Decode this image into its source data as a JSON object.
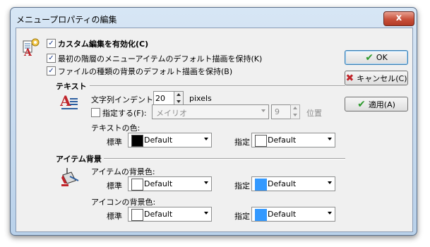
{
  "window": {
    "title": "メニュープロパティの編集",
    "close_glyph": "x"
  },
  "options": {
    "enable_custom": {
      "label": "カスタム編集を有効化(C)",
      "checked": true
    },
    "keep_first_level": {
      "label": "最初の階層のメニューアイテムのデフォルト描画を保持(K)",
      "checked": true
    },
    "keep_file_bg": {
      "label": "ファイルの種類の背景のデフォルト描画を保持(B)",
      "checked": true
    }
  },
  "text_section": {
    "header": "テキスト",
    "indent_label": "文字列インデント",
    "indent_value": "20",
    "indent_unit": "pixels",
    "specify_label": "指定する(F):",
    "font_value": "メイリオ",
    "size_value": "9",
    "position_label": "位置",
    "color_label": "テキストの色:",
    "standard_label": "標準",
    "standard_value": "Default",
    "standard_color": "#000000",
    "specified_label": "指定",
    "specified_value": "Default",
    "specified_color": "#ffffff"
  },
  "item_section": {
    "header": "アイテム背景",
    "item_bg_label": "アイテムの背景色:",
    "item_standard_label": "標準",
    "item_standard_value": "Default",
    "item_standard_color": "#ffffff",
    "item_specified_label": "指定",
    "item_specified_value": "Default",
    "item_specified_color": "#3399ff",
    "icon_bg_label": "アイコンの背景色:",
    "icon_standard_label": "標準",
    "icon_standard_value": "Default",
    "icon_standard_color": "#ffffff",
    "icon_specified_label": "指定",
    "icon_specified_value": "Default",
    "icon_specified_color": "#3399ff"
  },
  "buttons": {
    "ok": "OK",
    "cancel": "キャンセル(C)",
    "apply": "適用(A)"
  }
}
